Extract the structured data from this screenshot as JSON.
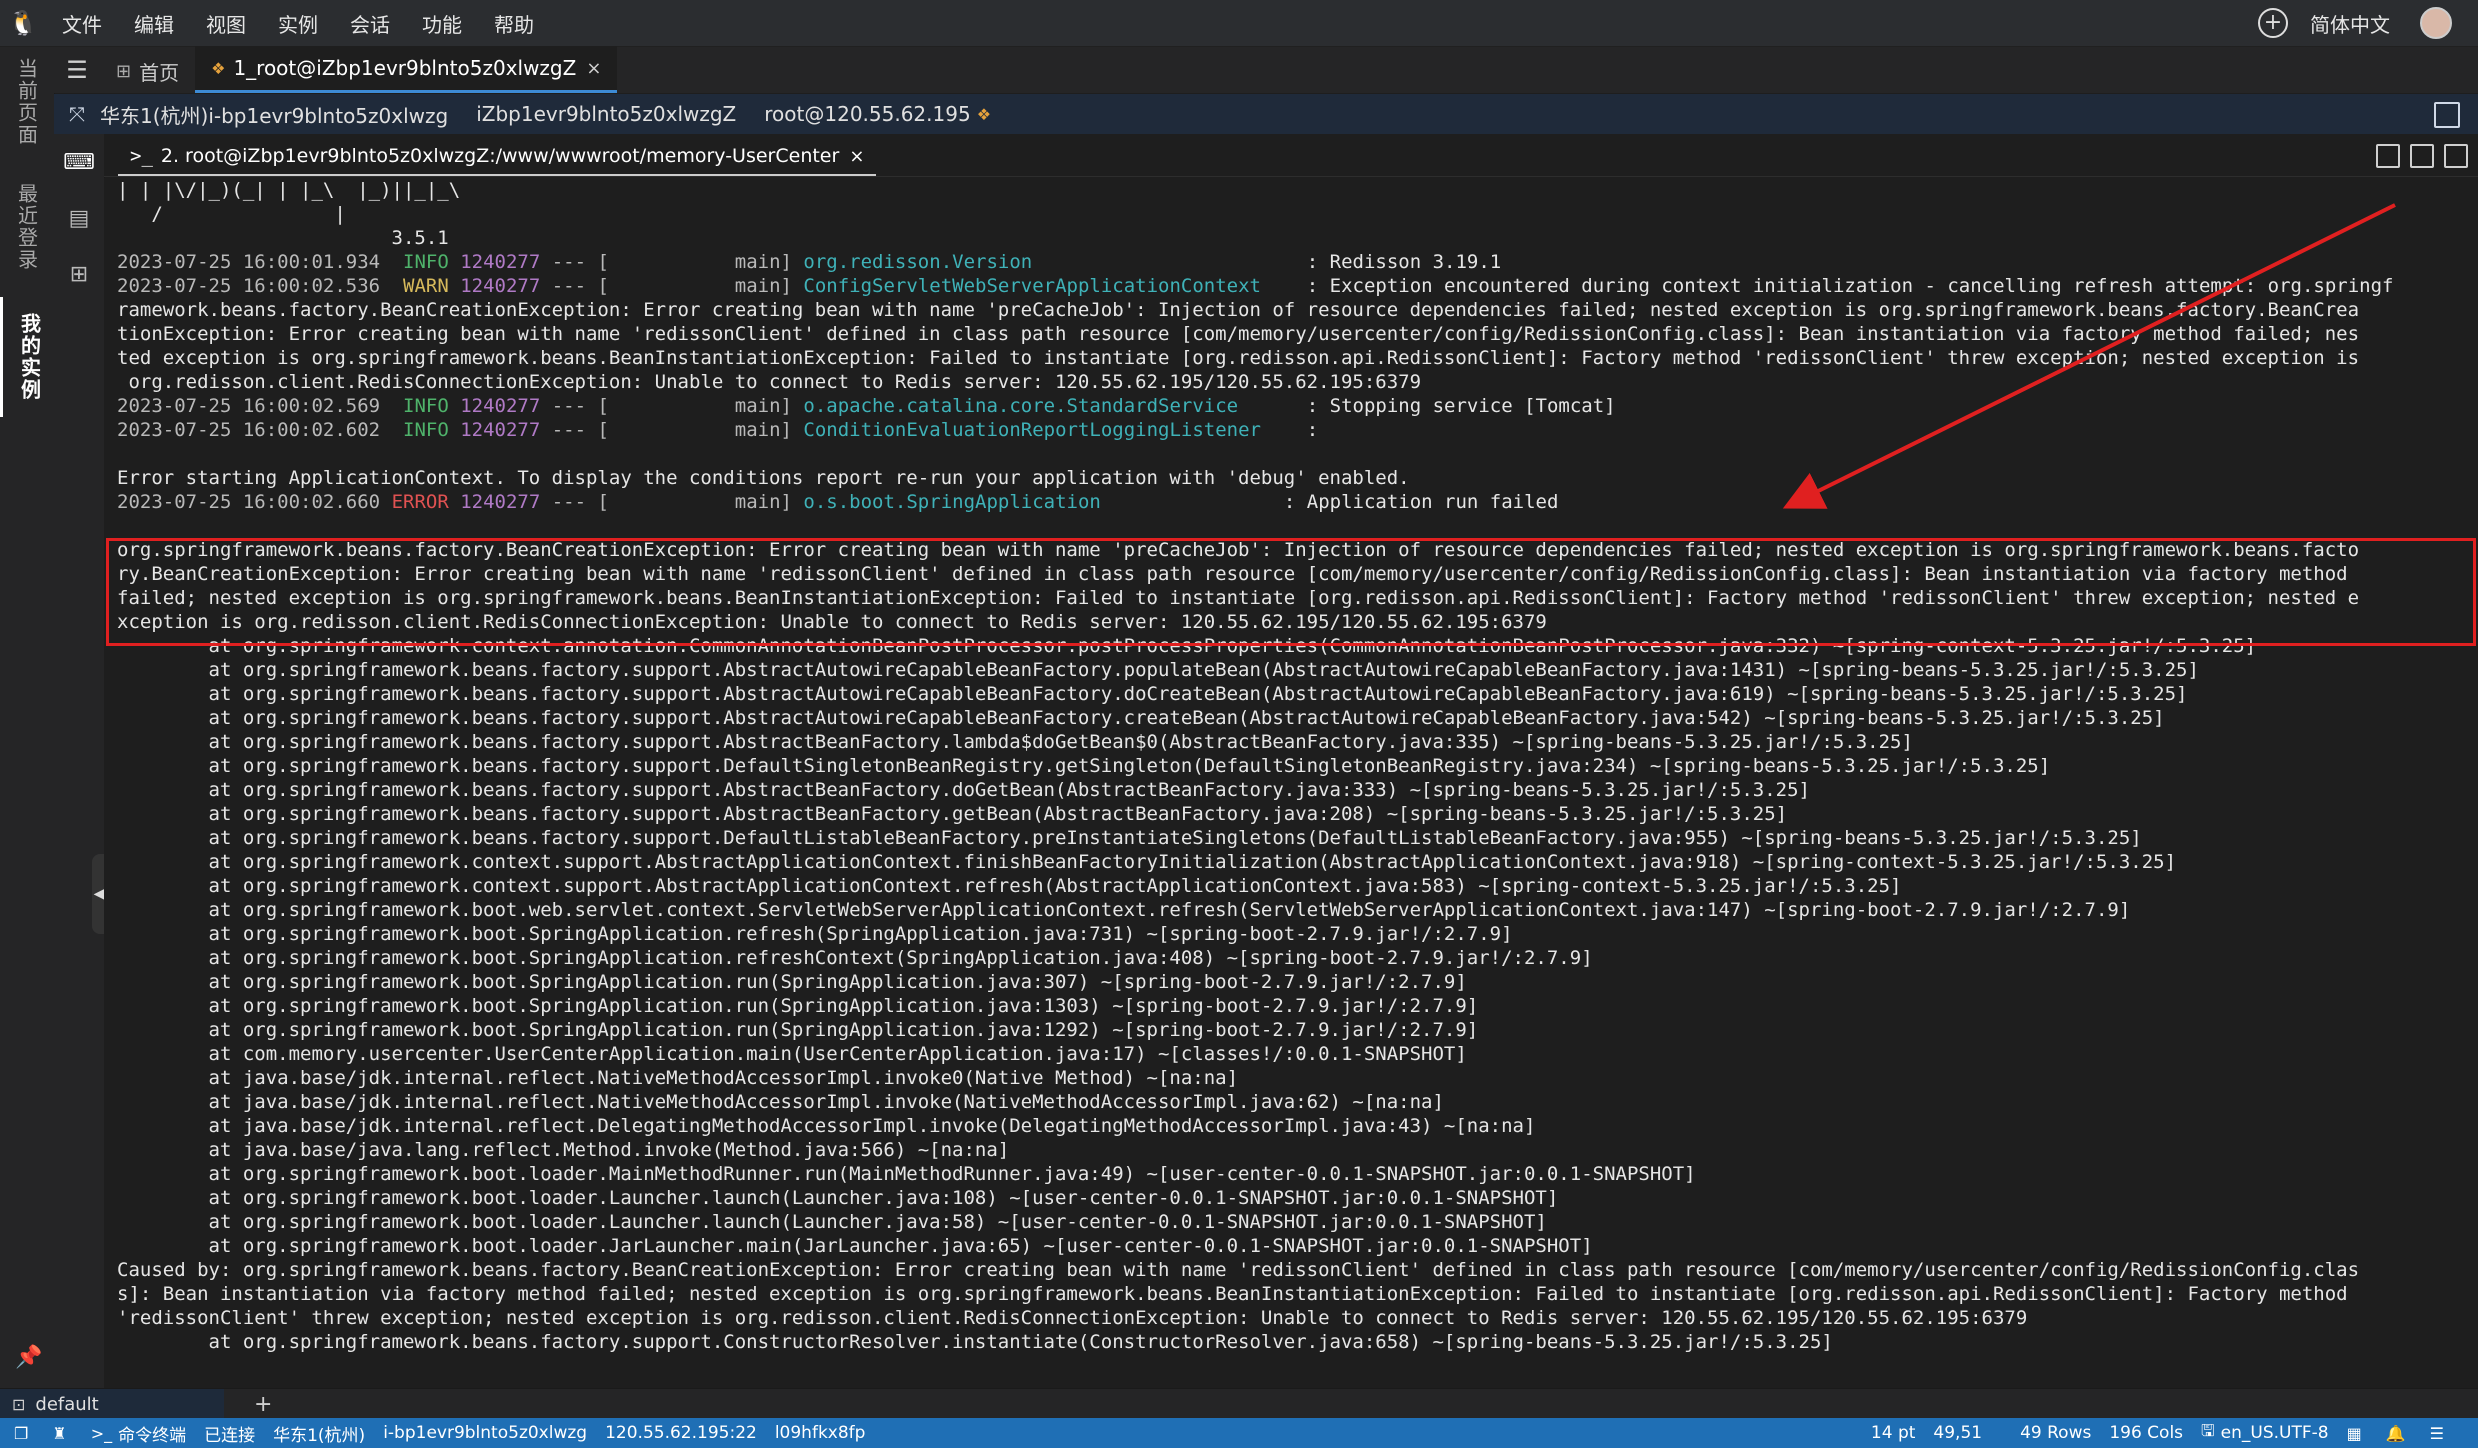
{
  "menubar": {
    "items": [
      "文件",
      "编辑",
      "视图",
      "实例",
      "会话",
      "功能",
      "帮助"
    ],
    "language": "简体中文"
  },
  "side_tabs": [
    {
      "label": "当前页面"
    },
    {
      "label": "最近登录"
    },
    {
      "label": "我的实例"
    }
  ],
  "tabs": [
    {
      "label": "首页"
    },
    {
      "label": "1_root@iZbp1evr9blnto5z0xlwzgZ"
    }
  ],
  "session": {
    "region_instance": "华东1(杭州)i-bp1evr9blnto5z0xlwzg",
    "hostname": "iZbp1evr9blnto5z0xlwzgZ",
    "user_ip": "root@120.55.62.195"
  },
  "terminal_tab": {
    "title": "2. root@iZbp1evr9blnto5z0xlwzgZ:/www/wwwroot/memory-UserCenter"
  },
  "log": {
    "banner": [
      "| | |\\/|_)(_| | |_\\  |_)||_|_\\",
      "   /               |",
      "                        3.5.1"
    ],
    "entries": [
      {
        "ts": "2023-07-25 16:00:01.934",
        "level": "INFO",
        "pid": "1240277",
        "sep": "--- [",
        "thread": "           main]",
        "logger": "org.redisson.Version",
        "pad": "                       ",
        "msg": ": Redisson 3.19.1"
      },
      {
        "ts": "2023-07-25 16:00:02.536",
        "level": "WARN",
        "pid": "1240277",
        "sep": "--- [",
        "thread": "           main]",
        "logger": "ConfigServletWebServerApplicationContext",
        "pad": "   ",
        "msg": ": Exception encountered during context initialization - cancelling refresh attempt: org.springf"
      }
    ],
    "warn_continuation": [
      "ramework.beans.factory.BeanCreationException: Error creating bean with name 'preCacheJob': Injection of resource dependencies failed; nested exception is org.springframework.beans.factory.BeanCrea",
      "tionException: Error creating bean with name 'redissonClient' defined in class path resource [com/memory/usercenter/config/RedissionConfig.class]: Bean instantiation via factory method failed; nes",
      "ted exception is org.springframework.beans.BeanInstantiationException: Failed to instantiate [org.redisson.api.RedissonClient]: Factory method 'redissonClient' threw exception; nested exception is",
      " org.redisson.client.RedisConnectionException: Unable to connect to Redis server: 120.55.62.195/120.55.62.195:6379"
    ],
    "entries2": [
      {
        "ts": "2023-07-25 16:00:02.569",
        "level": "INFO",
        "pid": "1240277",
        "sep": "--- [",
        "thread": "           main]",
        "logger": "o.apache.catalina.core.StandardService",
        "pad": "     ",
        "msg": ": Stopping service [Tomcat]"
      },
      {
        "ts": "2023-07-25 16:00:02.602",
        "level": "INFO",
        "pid": "1240277",
        "sep": "--- [",
        "thread": "           main]",
        "logger": "ConditionEvaluationReportLoggingListener",
        "pad": "   ",
        "msg": ":"
      }
    ],
    "blank_then_error_start": "Error starting ApplicationContext. To display the conditions report re-run your application with 'debug' enabled.",
    "entries3": [
      {
        "ts": "2023-07-25 16:00:02.660",
        "level": "ERROR",
        "pid": "1240277",
        "sep": "--- [",
        "thread": "           main]",
        "logger": "o.s.boot.SpringApplication",
        "pad": "               ",
        "msg": ": Application run failed"
      }
    ],
    "highlighted": [
      "org.springframework.beans.factory.BeanCreationException: Error creating bean with name 'preCacheJob': Injection of resource dependencies failed; nested exception is org.springframework.beans.facto",
      "ry.BeanCreationException: Error creating bean with name 'redissonClient' defined in class path resource [com/memory/usercenter/config/RedissionConfig.class]: Bean instantiation via factory method",
      "failed; nested exception is org.springframework.beans.BeanInstantiationException: Failed to instantiate [org.redisson.api.RedissonClient]: Factory method 'redissonClient' threw exception; nested e",
      "xception is org.redisson.client.RedisConnectionException: Unable to connect to Redis server: 120.55.62.195/120.55.62.195:6379"
    ],
    "stack": [
      "        at org.springframework.context.annotation.CommonAnnotationBeanPostProcessor.postProcessProperties(CommonAnnotationBeanPostProcessor.java:332) ~[spring-context-5.3.25.jar!/:5.3.25]",
      "        at org.springframework.beans.factory.support.AbstractAutowireCapableBeanFactory.populateBean(AbstractAutowireCapableBeanFactory.java:1431) ~[spring-beans-5.3.25.jar!/:5.3.25]",
      "        at org.springframework.beans.factory.support.AbstractAutowireCapableBeanFactory.doCreateBean(AbstractAutowireCapableBeanFactory.java:619) ~[spring-beans-5.3.25.jar!/:5.3.25]",
      "        at org.springframework.beans.factory.support.AbstractAutowireCapableBeanFactory.createBean(AbstractAutowireCapableBeanFactory.java:542) ~[spring-beans-5.3.25.jar!/:5.3.25]",
      "        at org.springframework.beans.factory.support.AbstractBeanFactory.lambda$doGetBean$0(AbstractBeanFactory.java:335) ~[spring-beans-5.3.25.jar!/:5.3.25]",
      "        at org.springframework.beans.factory.support.DefaultSingletonBeanRegistry.getSingleton(DefaultSingletonBeanRegistry.java:234) ~[spring-beans-5.3.25.jar!/:5.3.25]",
      "        at org.springframework.beans.factory.support.AbstractBeanFactory.doGetBean(AbstractBeanFactory.java:333) ~[spring-beans-5.3.25.jar!/:5.3.25]",
      "        at org.springframework.beans.factory.support.AbstractBeanFactory.getBean(AbstractBeanFactory.java:208) ~[spring-beans-5.3.25.jar!/:5.3.25]",
      "        at org.springframework.beans.factory.support.DefaultListableBeanFactory.preInstantiateSingletons(DefaultListableBeanFactory.java:955) ~[spring-beans-5.3.25.jar!/:5.3.25]",
      "        at org.springframework.context.support.AbstractApplicationContext.finishBeanFactoryInitialization(AbstractApplicationContext.java:918) ~[spring-context-5.3.25.jar!/:5.3.25]",
      "        at org.springframework.context.support.AbstractApplicationContext.refresh(AbstractApplicationContext.java:583) ~[spring-context-5.3.25.jar!/:5.3.25]",
      "        at org.springframework.boot.web.servlet.context.ServletWebServerApplicationContext.refresh(ServletWebServerApplicationContext.java:147) ~[spring-boot-2.7.9.jar!/:2.7.9]",
      "        at org.springframework.boot.SpringApplication.refresh(SpringApplication.java:731) ~[spring-boot-2.7.9.jar!/:2.7.9]",
      "        at org.springframework.boot.SpringApplication.refreshContext(SpringApplication.java:408) ~[spring-boot-2.7.9.jar!/:2.7.9]",
      "        at org.springframework.boot.SpringApplication.run(SpringApplication.java:307) ~[spring-boot-2.7.9.jar!/:2.7.9]",
      "        at org.springframework.boot.SpringApplication.run(SpringApplication.java:1303) ~[spring-boot-2.7.9.jar!/:2.7.9]",
      "        at org.springframework.boot.SpringApplication.run(SpringApplication.java:1292) ~[spring-boot-2.7.9.jar!/:2.7.9]",
      "        at com.memory.usercenter.UserCenterApplication.main(UserCenterApplication.java:17) ~[classes!/:0.0.1-SNAPSHOT]",
      "        at java.base/jdk.internal.reflect.NativeMethodAccessorImpl.invoke0(Native Method) ~[na:na]",
      "        at java.base/jdk.internal.reflect.NativeMethodAccessorImpl.invoke(NativeMethodAccessorImpl.java:62) ~[na:na]",
      "        at java.base/jdk.internal.reflect.DelegatingMethodAccessorImpl.invoke(DelegatingMethodAccessorImpl.java:43) ~[na:na]",
      "        at java.base/java.lang.reflect.Method.invoke(Method.java:566) ~[na:na]",
      "        at org.springframework.boot.loader.MainMethodRunner.run(MainMethodRunner.java:49) ~[user-center-0.0.1-SNAPSHOT.jar:0.0.1-SNAPSHOT]",
      "        at org.springframework.boot.loader.Launcher.launch(Launcher.java:108) ~[user-center-0.0.1-SNAPSHOT.jar:0.0.1-SNAPSHOT]",
      "        at org.springframework.boot.loader.Launcher.launch(Launcher.java:58) ~[user-center-0.0.1-SNAPSHOT.jar:0.0.1-SNAPSHOT]",
      "        at org.springframework.boot.loader.JarLauncher.main(JarLauncher.java:65) ~[user-center-0.0.1-SNAPSHOT.jar:0.0.1-SNAPSHOT]",
      "Caused by: org.springframework.beans.factory.BeanCreationException: Error creating bean with name 'redissonClient' defined in class path resource [com/memory/usercenter/config/RedissionConfig.clas",
      "s]: Bean instantiation via factory method failed; nested exception is org.springframework.beans.BeanInstantiationException: Failed to instantiate [org.redisson.api.RedissonClient]: Factory method",
      "'redissonClient' threw exception; nested exception is org.redisson.client.RedisConnectionException: Unable to connect to Redis server: 120.55.62.195/120.55.62.195:6379",
      "        at org.springframework.beans.factory.support.ConstructorResolver.instantiate(ConstructorResolver.java:658) ~[spring-beans-5.3.25.jar!/:5.3.25]"
    ]
  },
  "bottom": {
    "shell_tab": "default"
  },
  "statusbar": {
    "terminal_label": "命令终端",
    "connected": "已连接",
    "region": "华东1(杭州)",
    "instance": "i-bp1evr9blnto5z0xlwzg",
    "endpoint": "120.55.62.195:22",
    "session_id": "l09hfkx8fp",
    "font_size": "14 pt",
    "cursor": "49,51",
    "rows": "49 Rows",
    "cols": "196 Cols",
    "encoding": "en_US.UTF-8"
  },
  "colors": {
    "accent": "#1f6fb5",
    "highlight_box": "#e02020",
    "arrow": "#e02020",
    "info": "#4fb36b",
    "warn": "#d7ba5c",
    "error": "#e05252"
  }
}
